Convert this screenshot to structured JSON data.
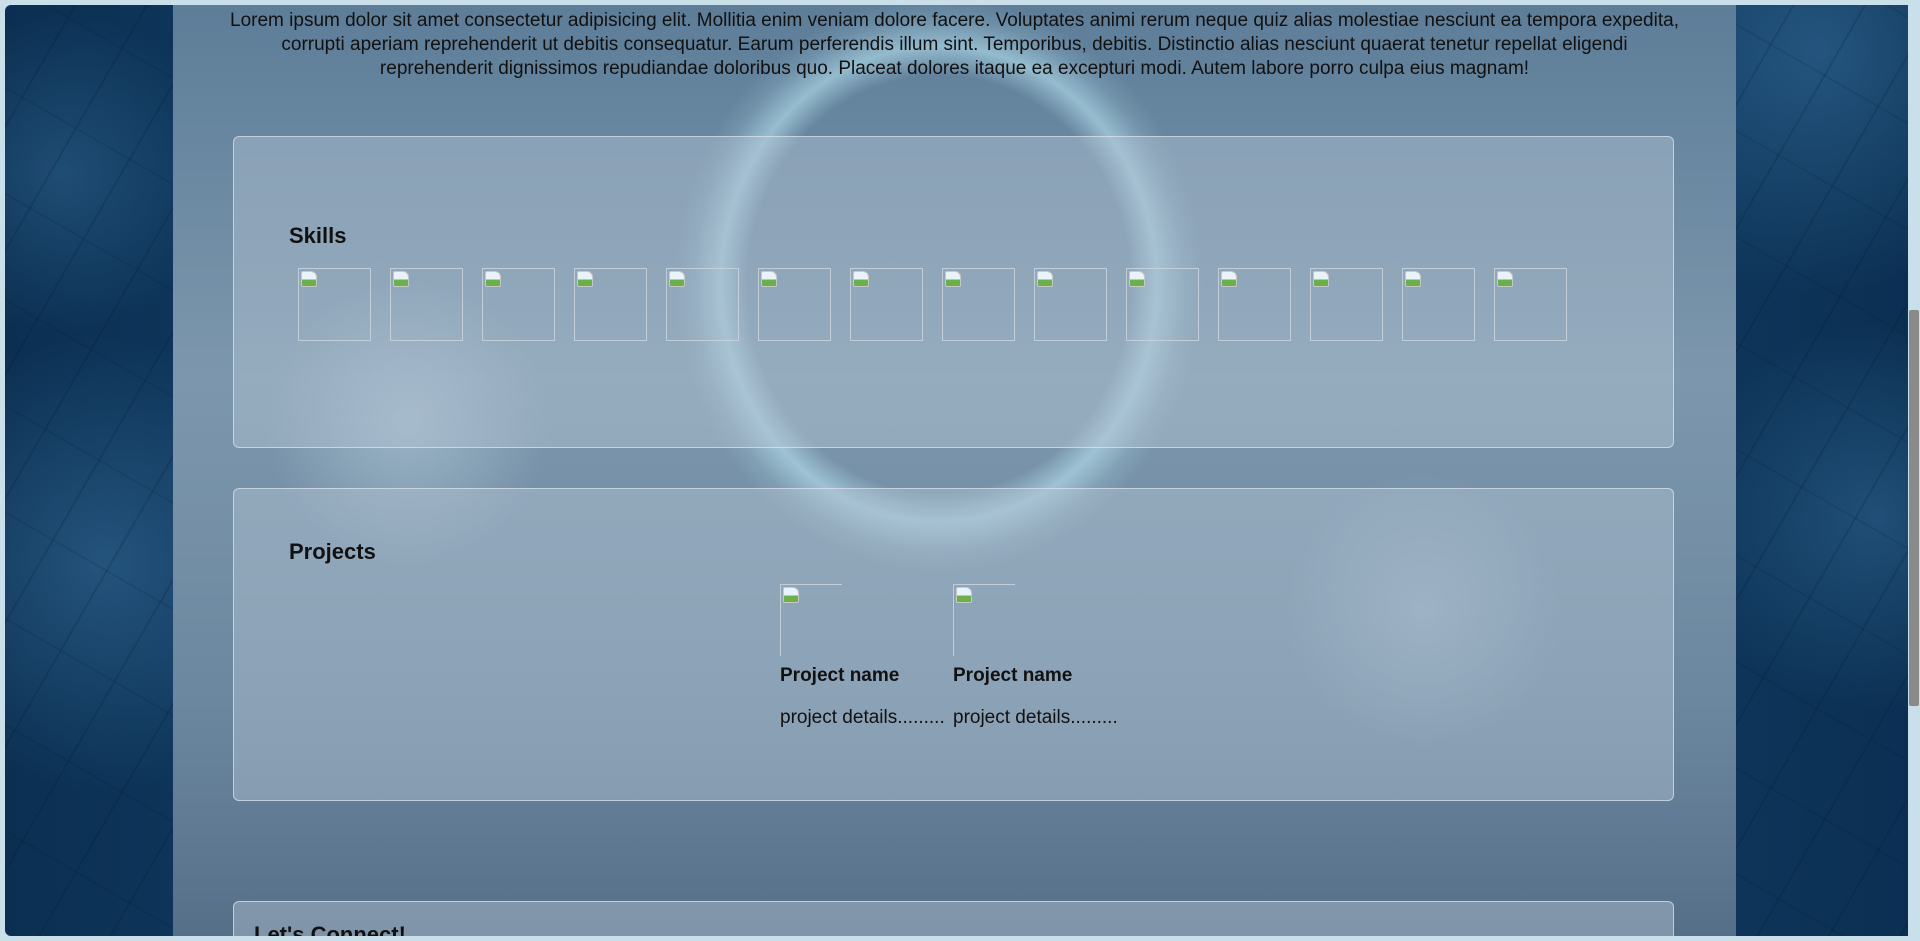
{
  "intro": {
    "text": "Lorem ipsum dolor sit amet consectetur adipisicing elit. Mollitia enim veniam dolore facere. Voluptates animi rerum neque quiz alias molestiae nesciunt ea tempora expedita, corrupti aperiam reprehenderit ut debitis consequatur. Earum perferendis illum sint. Temporibus, debitis. Distinctio alias nesciunt quaerat tenetur repellat eligendi reprehenderit dignissimos repudiandae doloribus quo. Placeat dolores itaque ea excepturi modi. Autem labore porro culpa eius magnam!"
  },
  "skills": {
    "title": "Skills",
    "items": [
      {
        "icon": "broken-image-icon"
      },
      {
        "icon": "broken-image-icon"
      },
      {
        "icon": "broken-image-icon"
      },
      {
        "icon": "broken-image-icon"
      },
      {
        "icon": "broken-image-icon"
      },
      {
        "icon": "broken-image-icon"
      },
      {
        "icon": "broken-image-icon"
      },
      {
        "icon": "broken-image-icon"
      },
      {
        "icon": "broken-image-icon"
      },
      {
        "icon": "broken-image-icon"
      },
      {
        "icon": "broken-image-icon"
      },
      {
        "icon": "broken-image-icon"
      },
      {
        "icon": "broken-image-icon"
      },
      {
        "icon": "broken-image-icon"
      }
    ]
  },
  "projects": {
    "title": "Projects",
    "items": [
      {
        "name": "Project name",
        "details": "project details........."
      },
      {
        "name": "Project name",
        "details": "project details........."
      }
    ]
  },
  "connect": {
    "title": "Let's Connect!"
  },
  "colors": {
    "background": "#0b2f52",
    "card": "#b4c4d2",
    "text": "#111111"
  }
}
